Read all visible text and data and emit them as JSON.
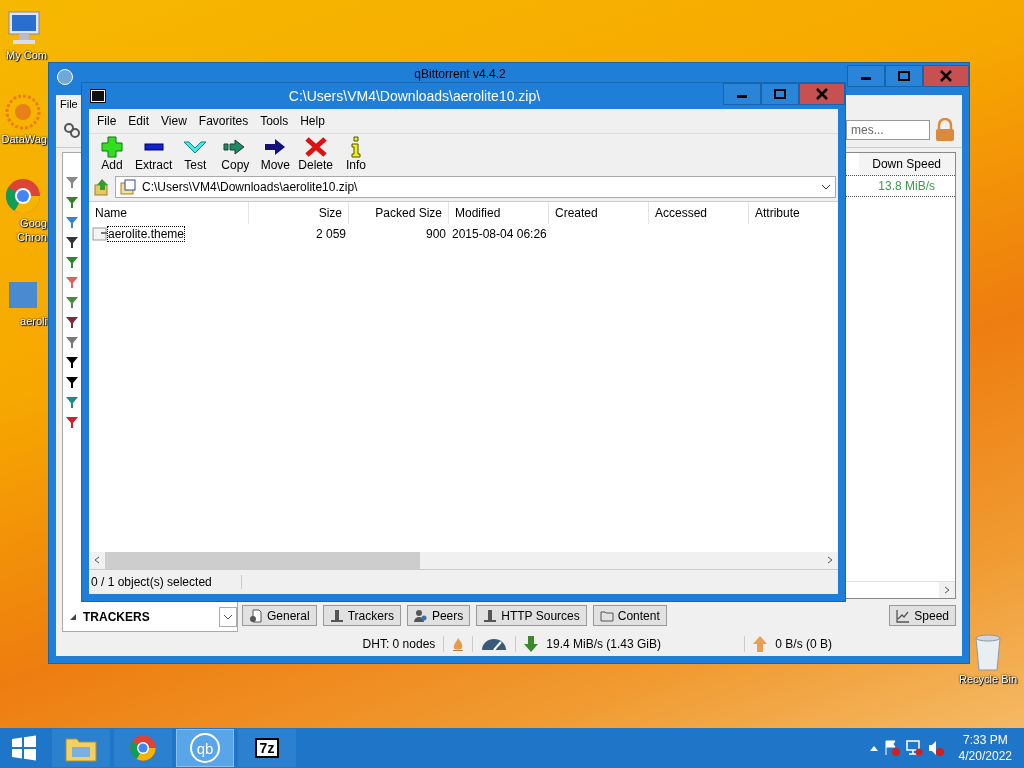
{
  "desktop_icons": [
    {
      "kind": "computer",
      "lines": [
        "My Com"
      ]
    },
    {
      "kind": "sunburst",
      "lines": [
        "DataWag"
      ]
    },
    {
      "kind": "chrome",
      "lines": [
        "Goog",
        "Chron"
      ]
    },
    {
      "kind": "folder",
      "lines": [
        "aeroli"
      ]
    }
  ],
  "recycle_bin": {
    "lines": [
      "Recycle Bin"
    ]
  },
  "qbittorrent": {
    "title": "qBittorrent v4.4.2",
    "menu": [
      "File"
    ],
    "search": {
      "placeholder": "mes..."
    },
    "columns": [
      "Down Speed"
    ],
    "rows": [
      {
        "down_speed": "13.8 MiB/s"
      }
    ],
    "sidebar_header": "TRACKERS",
    "tabs": [
      {
        "label": "General",
        "kind": "general"
      },
      {
        "label": "Trackers",
        "kind": "server"
      },
      {
        "label": "Peers",
        "kind": "peers"
      },
      {
        "label": "HTTP Sources",
        "kind": "server"
      },
      {
        "label": "Content",
        "kind": "folder"
      }
    ],
    "speed_button": "Speed",
    "status": {
      "dht": "DHT: 0 nodes",
      "download": "19.4 MiB/s (1.43 GiB)",
      "upload": "0 B/s (0 B)"
    }
  },
  "sevenzip": {
    "title": "C:\\Users\\VM4\\Downloads\\aerolite10.zip\\",
    "menu": [
      "File",
      "Edit",
      "View",
      "Favorites",
      "Tools",
      "Help"
    ],
    "toolbar": [
      {
        "label": "Add",
        "kind": "add"
      },
      {
        "label": "Extract",
        "kind": "extract"
      },
      {
        "label": "Test",
        "kind": "test"
      },
      {
        "label": "Copy",
        "kind": "copy"
      },
      {
        "label": "Move",
        "kind": "move"
      },
      {
        "label": "Delete",
        "kind": "delete"
      },
      {
        "label": "Info",
        "kind": "info"
      }
    ],
    "address": "C:\\Users\\VM4\\Downloads\\aerolite10.zip\\",
    "columns": [
      "Name",
      "Size",
      "Packed Size",
      "Modified",
      "Created",
      "Accessed",
      "Attribute"
    ],
    "rows": [
      {
        "name": "aerolite.theme",
        "size": "2 059",
        "packed_size": "900",
        "modified": "2015-08-04 06:26",
        "selected": false,
        "focused": true
      }
    ],
    "status": "0 / 1 object(s) selected"
  },
  "taskbar": {
    "apps": [
      {
        "kind": "explorer",
        "selected": false
      },
      {
        "kind": "chrome",
        "selected": false
      },
      {
        "kind": "qbittorrent",
        "label": "qb",
        "selected": true
      },
      {
        "kind": "sevenzip",
        "label": "7z",
        "selected": false
      }
    ],
    "time": "7:33 PM",
    "date": "4/20/2022"
  }
}
